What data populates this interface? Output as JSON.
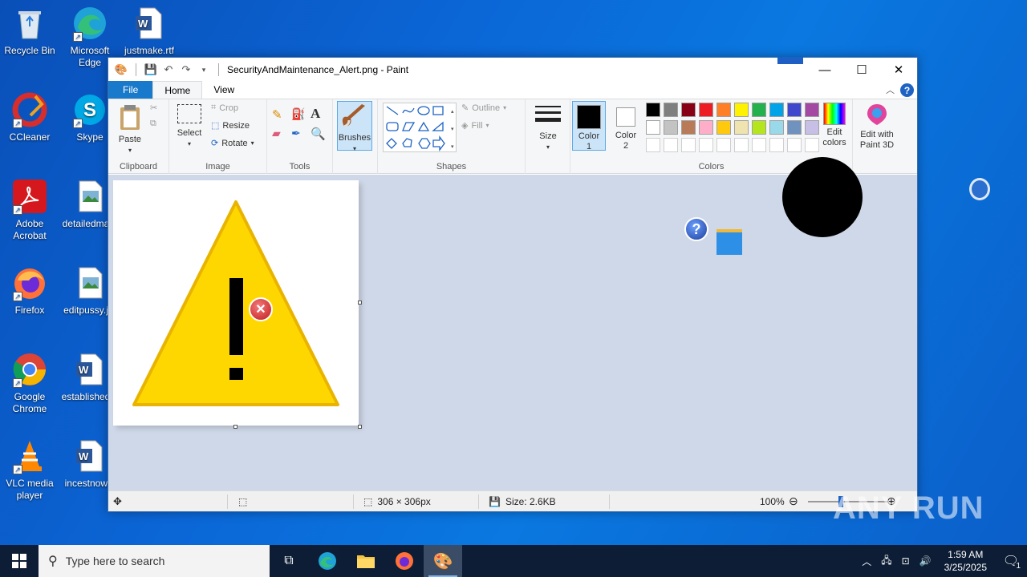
{
  "desktop": {
    "icons": [
      {
        "label": "Recycle Bin"
      },
      {
        "label": "Microsoft Edge"
      },
      {
        "label": "justmake.rtf"
      },
      {
        "label": "CCleaner"
      },
      {
        "label": "Skype"
      },
      {
        "label": "Adobe Acrobat"
      },
      {
        "label": "detailedma..."
      },
      {
        "label": "Firefox"
      },
      {
        "label": "editpussy.j..."
      },
      {
        "label": "Google Chrome"
      },
      {
        "label": "established..."
      },
      {
        "label": "VLC media player"
      },
      {
        "label": "incestnow..."
      }
    ]
  },
  "window": {
    "title": "SecurityAndMaintenance_Alert.png - Paint",
    "controls": {
      "minimize": "—",
      "maximize": "☐",
      "close": "✕"
    },
    "tabs": [
      "File",
      "Home",
      "View"
    ],
    "help": "?"
  },
  "ribbon": {
    "clipboard": {
      "group": "Clipboard",
      "paste": "Paste"
    },
    "image": {
      "group": "Image",
      "select": "Select",
      "crop": "Crop",
      "resize": "Resize",
      "rotate": "Rotate"
    },
    "tools": {
      "group": "Tools",
      "text": "A"
    },
    "brushes": {
      "label": "Brushes"
    },
    "shapes": {
      "group": "Shapes",
      "outline": "Outline",
      "fill": "Fill"
    },
    "size": {
      "label": "Size"
    },
    "colors": {
      "group": "Colors",
      "color1": "Color 1",
      "color2": "Color 2",
      "edit_colors": "Edit colors",
      "edit_paint3d": "Edit with Paint 3D",
      "color1_value": "#000000",
      "color2_value": "#ffffff",
      "palette_row1": [
        "#000000",
        "#7f7f7f",
        "#880015",
        "#ed1c24",
        "#ff7f27",
        "#fff200",
        "#22b14c",
        "#00a2e8",
        "#3f48cc",
        "#a349a4"
      ],
      "palette_row2": [
        "#ffffff",
        "#c3c3c3",
        "#b97a57",
        "#ffaec9",
        "#ffc90e",
        "#efe4b0",
        "#b5e61d",
        "#99d9ea",
        "#7092be",
        "#c8bfe7"
      ]
    }
  },
  "status": {
    "dimensions": "306 × 306px",
    "size": "Size: 2.6KB",
    "zoom": "100%"
  },
  "taskbar": {
    "search_placeholder": "Type here to search",
    "time": "1:59 AM",
    "date": "3/25/2025",
    "notifications": "1"
  },
  "watermark": "ANY RUN"
}
